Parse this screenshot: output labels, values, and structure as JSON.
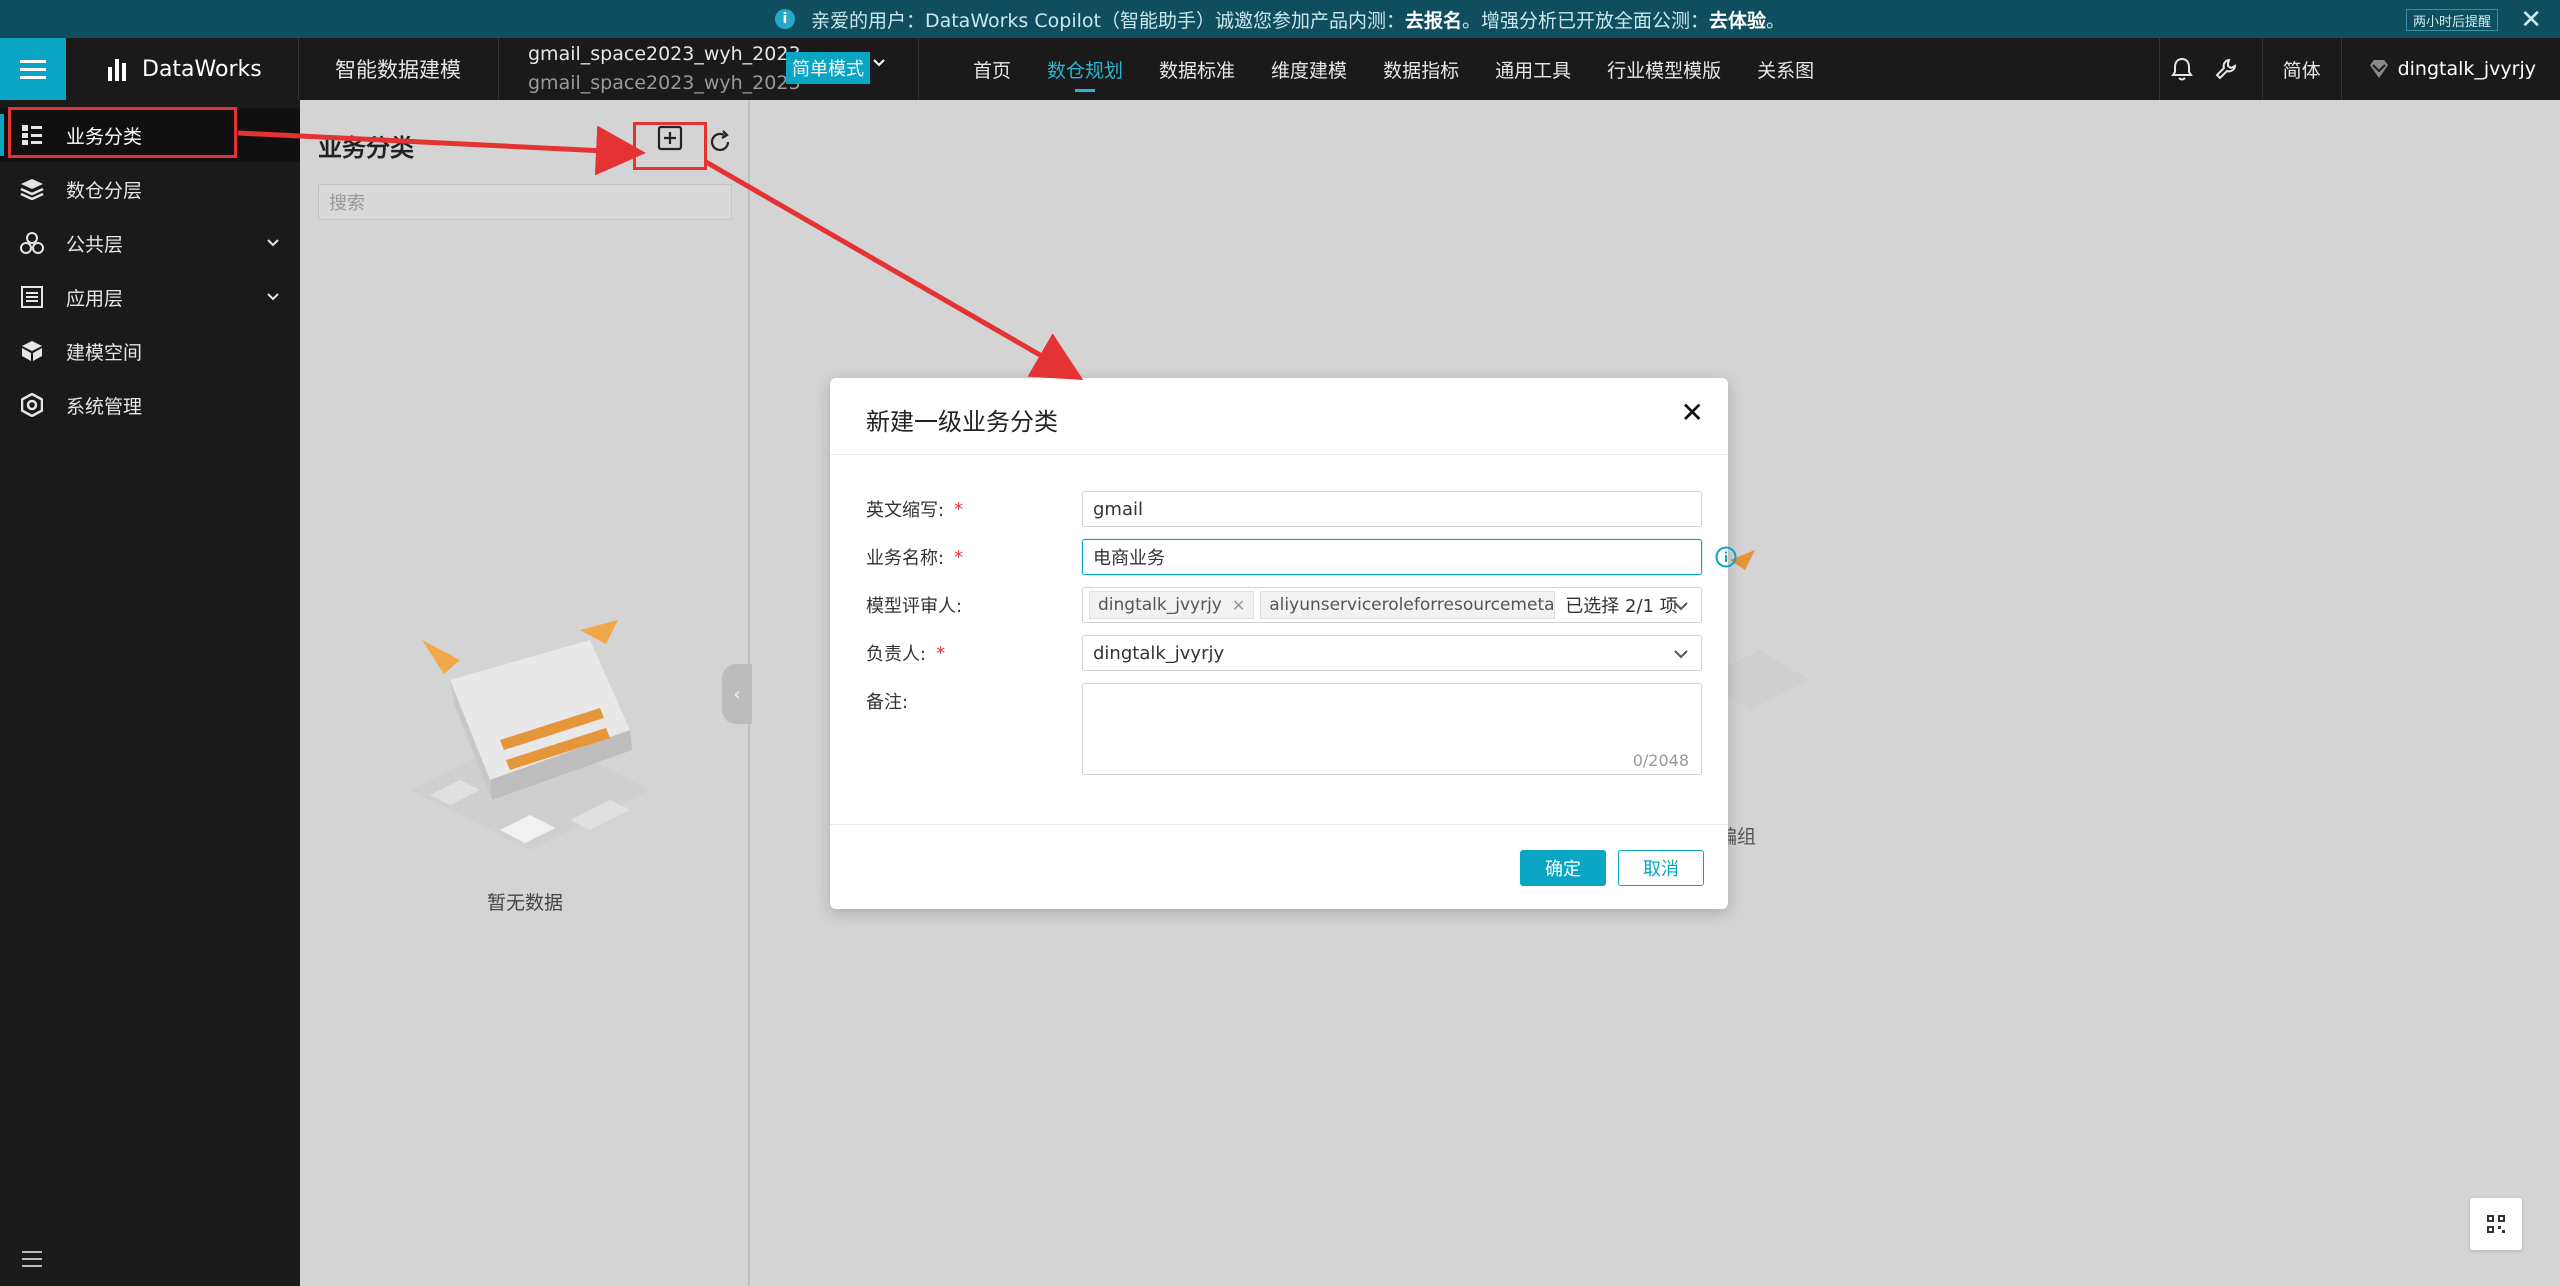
{
  "notice": {
    "text_before": "亲爱的用户：DataWorks Copilot（智能助手）诚邀您参加产品内测：",
    "signup_link": "去报名",
    "text_middle": "。增强分析已开放全面公测：",
    "try_link": "去体验",
    "text_after": "。",
    "remind_label": "两小时后提醒"
  },
  "header": {
    "logo_text": "DataWorks",
    "product_name": "智能数据建模",
    "workspace_name": "gmail_space2023_wyh_2023",
    "workspace_sub": "gmail_space2023_wyh_2023",
    "mode_label": "简单模式",
    "nav": [
      "首页",
      "数仓规划",
      "数据标准",
      "维度建模",
      "数据指标",
      "通用工具",
      "行业模型模版",
      "关系图"
    ],
    "active_nav": "数仓规划",
    "lang_label": "简体",
    "user_name": "dingtalk_jvyrjy"
  },
  "sidebar": {
    "items": [
      {
        "label": "业务分类",
        "icon": "grid-list-icon"
      },
      {
        "label": "数仓分层",
        "icon": "layers-icon"
      },
      {
        "label": "公共层",
        "icon": "cubes-icon"
      },
      {
        "label": "应用层",
        "icon": "list-box-icon"
      },
      {
        "label": "建模空间",
        "icon": "cube-icon"
      },
      {
        "label": "系统管理",
        "icon": "hexagon-settings-icon"
      }
    ],
    "active_item": "业务分类"
  },
  "panel": {
    "title": "业务分类",
    "search_placeholder": "搜索",
    "empty_text": "暂无数据"
  },
  "background": {
    "partial_text": "编组"
  },
  "modal": {
    "title": "新建一级业务分类",
    "fields": {
      "abbr_label": "英文缩写:",
      "abbr_value": "gmail",
      "name_label": "业务名称:",
      "name_value": "电商业务",
      "reviewer_label": "模型评审人:",
      "reviewer_tags": [
        "dingtalk_jvyrjy",
        "aliyunserviceroleforresourcemetacenter"
      ],
      "reviewer_count": "已选择 2/1 项",
      "owner_label": "负责人:",
      "owner_value": "dingtalk_jvyrjy",
      "remark_label": "备注:",
      "remark_count": "0/2048"
    },
    "ok_label": "确定",
    "cancel_label": "取消"
  },
  "colors": {
    "accent": "#0aa5c3",
    "annotation": "#e53333",
    "header_bg": "#1a1a1a"
  }
}
